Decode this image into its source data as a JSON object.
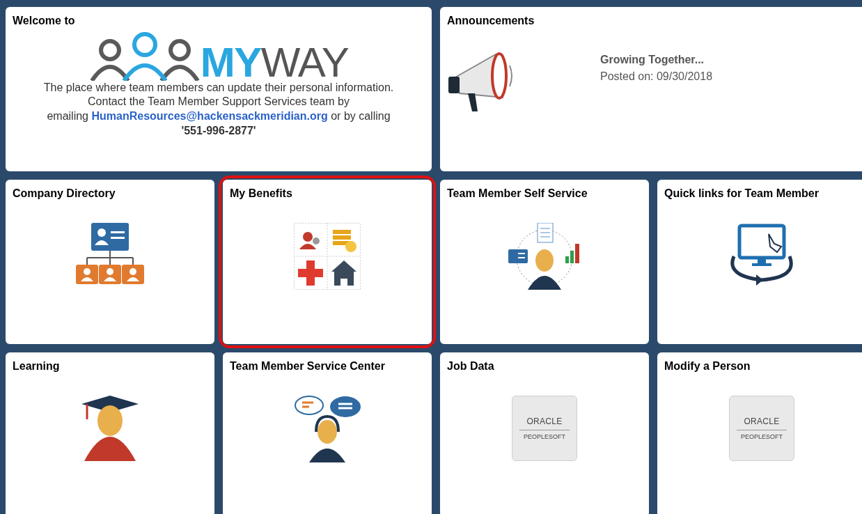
{
  "welcome": {
    "title": "Welcome to",
    "logo": {
      "strong": "MY",
      "light": "WAY"
    },
    "lines": [
      "The place where team members can update their personal information.",
      "Contact the Team Member Support Services team by"
    ],
    "email_prefix": "emailing",
    "email": "HumanResources@hackensackmeridian.org",
    "email_suffix": "or by calling",
    "phone": "'551-996-2877'"
  },
  "announcements": {
    "title": "Announcements",
    "headline": "Growing Together...",
    "posted": "Posted on: 09/30/2018"
  },
  "tiles": [
    {
      "title": "Company Directory",
      "kind": "directory",
      "highlighted": false
    },
    {
      "title": "My Benefits",
      "kind": "benefits",
      "highlighted": true
    },
    {
      "title": "Team Member Self Service",
      "kind": "selfservice",
      "highlighted": false
    },
    {
      "title": "Quick links for Team Member",
      "kind": "quicklinks",
      "highlighted": false
    },
    {
      "title": "Learning",
      "kind": "learning",
      "highlighted": false
    },
    {
      "title": "Team Member Service Center",
      "kind": "servicecenter",
      "highlighted": false
    },
    {
      "title": "Job Data",
      "kind": "oracle",
      "highlighted": false,
      "logo_top": "ORACLE",
      "logo_bottom": "PEOPLESOFT"
    },
    {
      "title": "Modify a Person",
      "kind": "oracle",
      "highlighted": false,
      "logo_top": "ORACLE",
      "logo_bottom": "PEOPLESOFT"
    }
  ]
}
